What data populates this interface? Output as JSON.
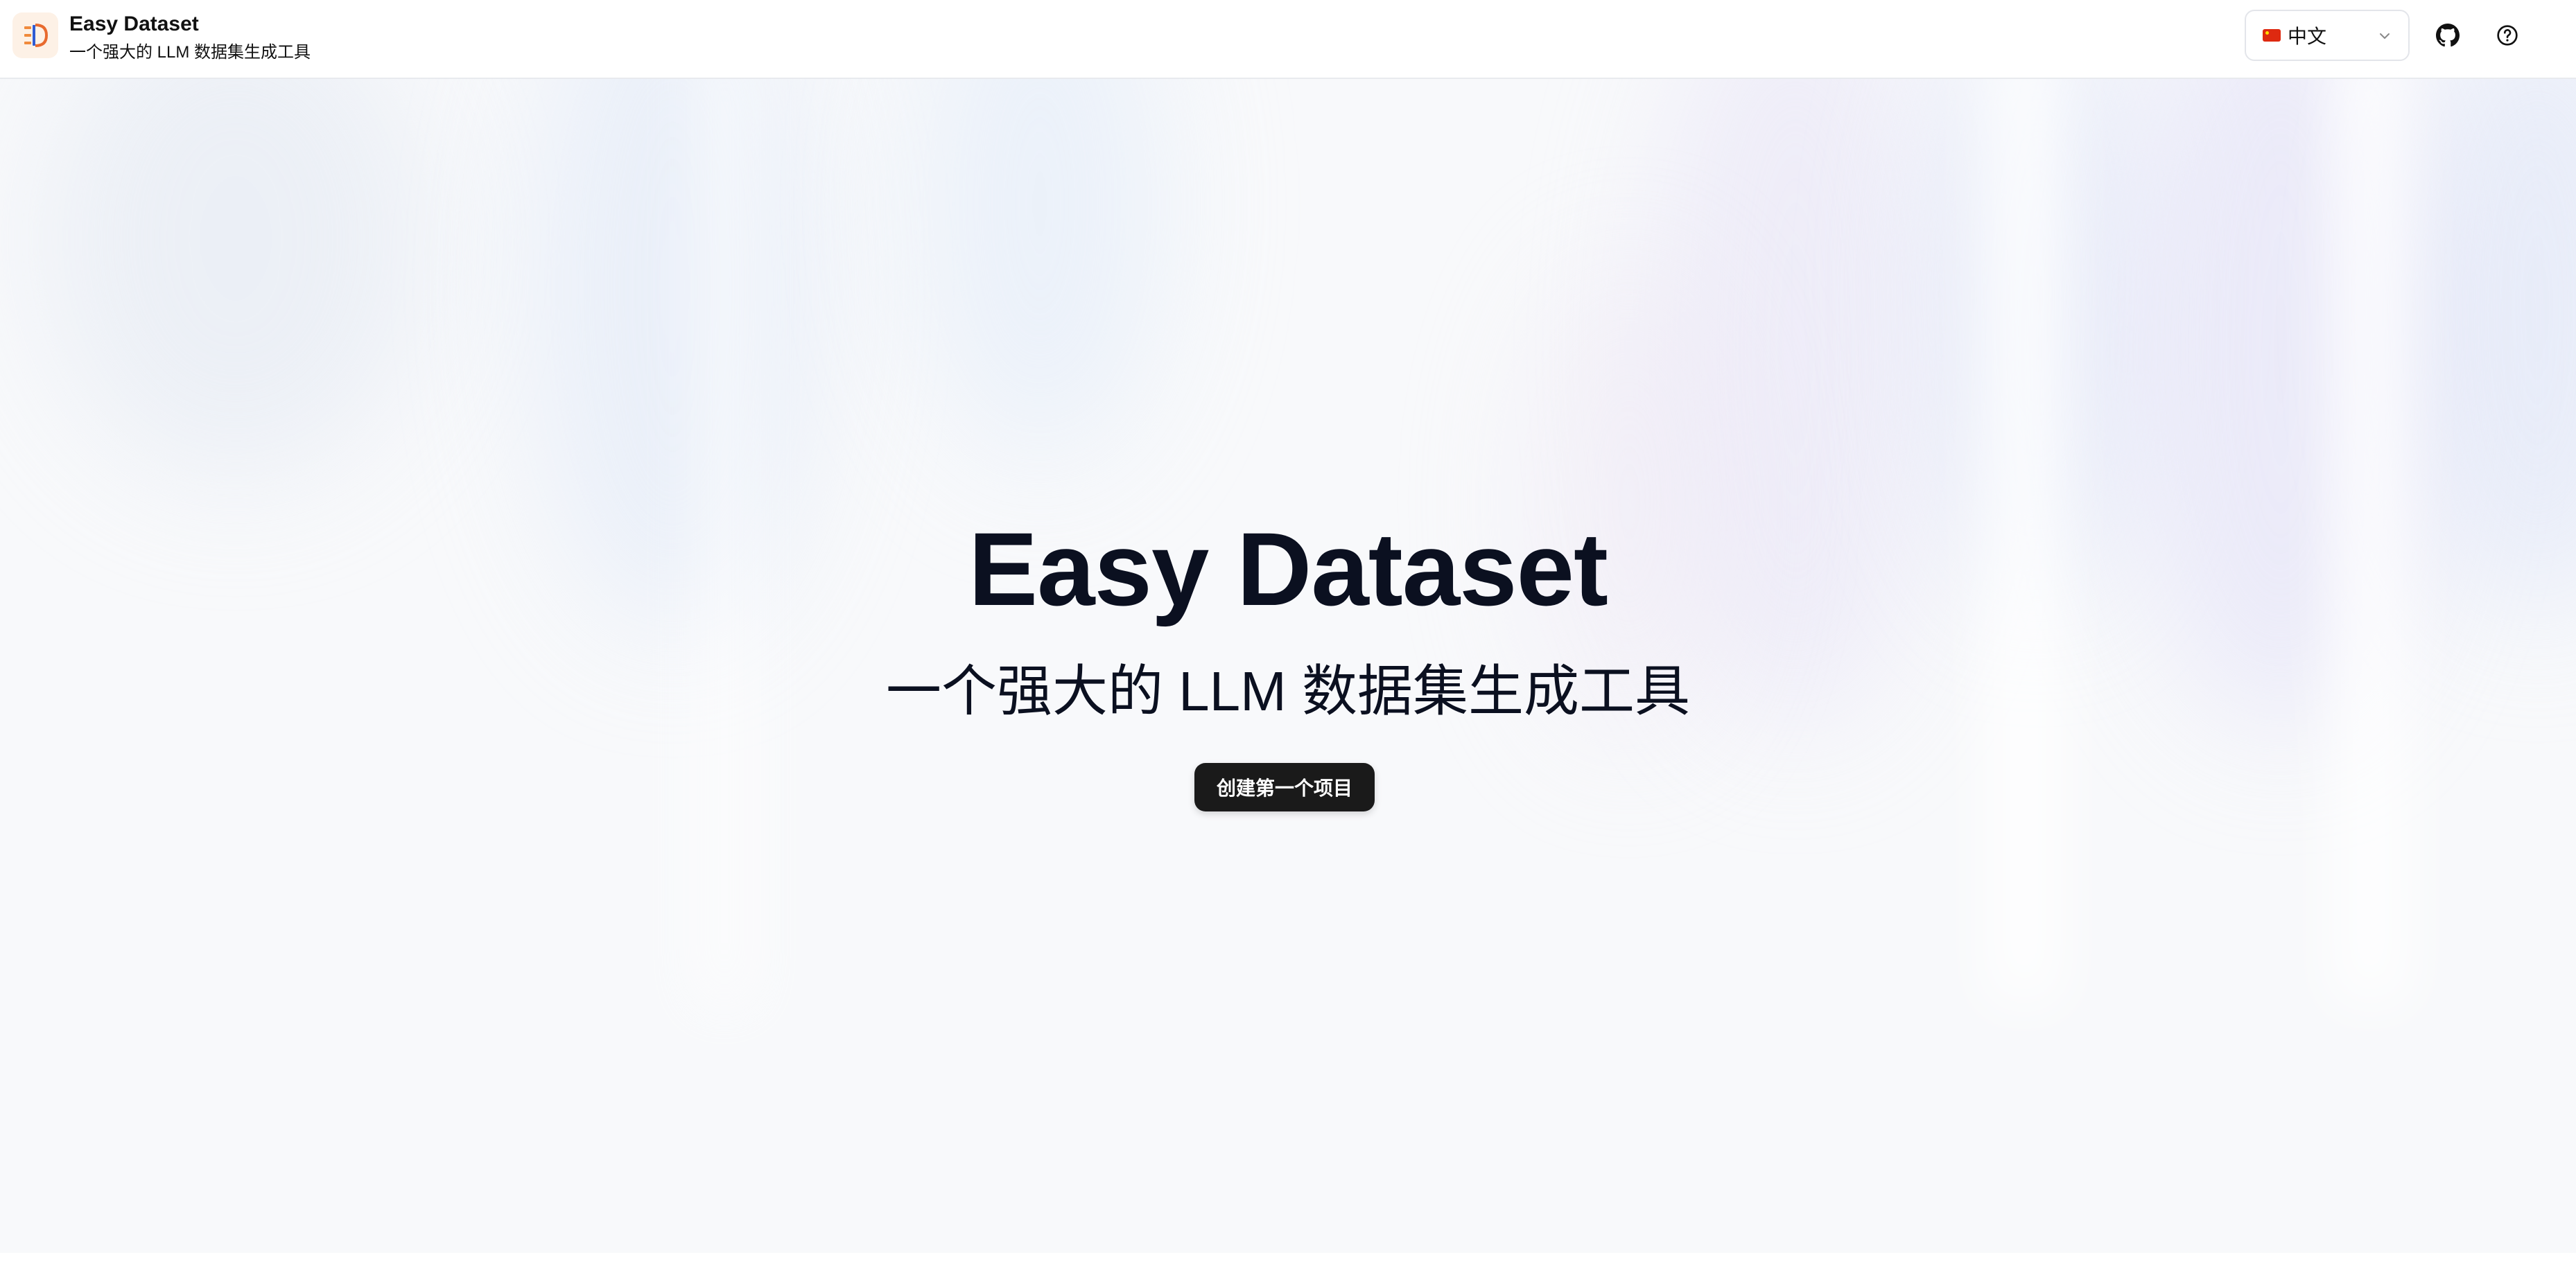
{
  "header": {
    "app_name": "Easy Dataset",
    "tagline": "一个强大的 LLM 数据集生成工具",
    "language": {
      "selected": "中文",
      "flag": "cn-flag"
    },
    "icons": [
      "github-icon",
      "help-icon"
    ]
  },
  "hero": {
    "title": "Easy Dataset",
    "subtitle": "一个强大的 LLM 数据集生成工具",
    "cta_label": "创建第一个项目"
  },
  "colors": {
    "accent": "#1a1a1a",
    "text": "#0b1020",
    "logo_orange": "#f08a3c",
    "logo_blue": "#2f5bd3",
    "background": "#f8f9fb"
  }
}
